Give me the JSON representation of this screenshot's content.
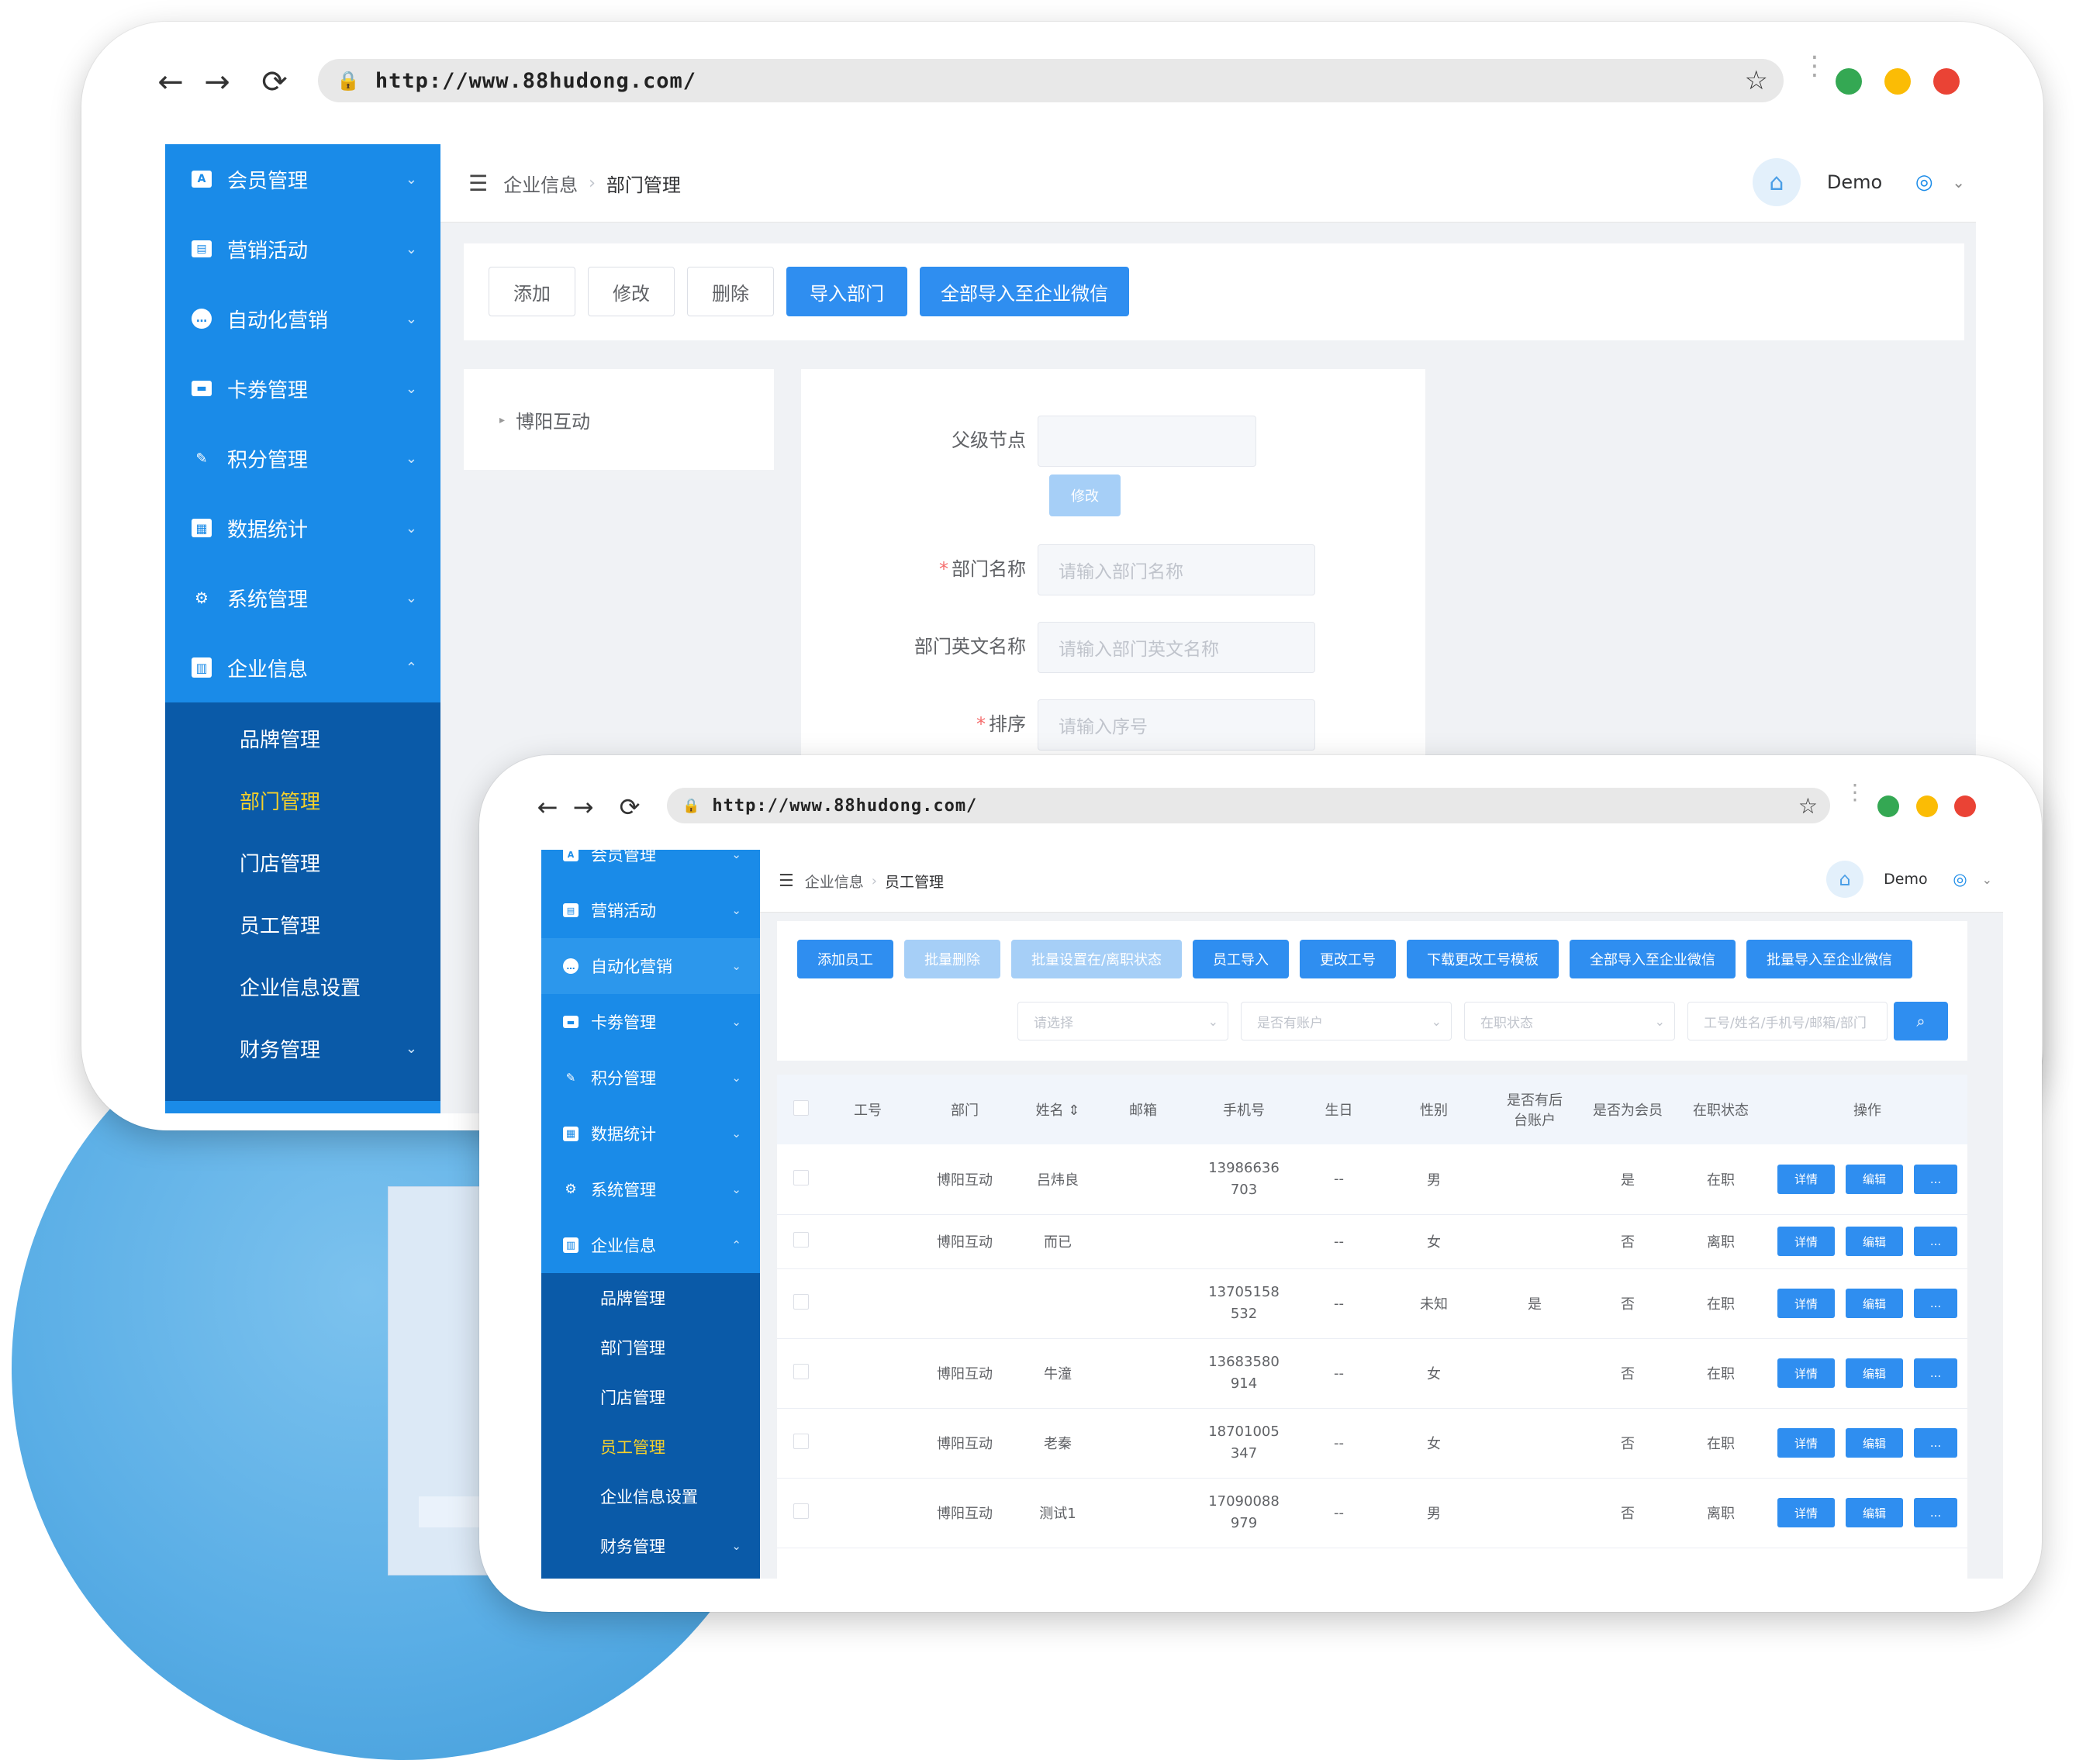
{
  "browser": {
    "url": "http://www.88hudong.com/",
    "light_colors": [
      "#34a853",
      "#fbbc05",
      "#ea4335"
    ]
  },
  "sidebar": {
    "items": [
      {
        "label": "会员管理",
        "icon": "member-card-icon",
        "glyph": "A"
      },
      {
        "label": "营销活动",
        "icon": "ticket-icon",
        "glyph": "▤"
      },
      {
        "label": "自动化营销",
        "icon": "chat-icon",
        "glyph": "…"
      },
      {
        "label": "卡劵管理",
        "icon": "card-icon",
        "glyph": "▬"
      },
      {
        "label": "积分管理",
        "icon": "pen-icon",
        "glyph": "✎"
      },
      {
        "label": "数据统计",
        "icon": "grid-icon",
        "glyph": "▦"
      },
      {
        "label": "系统管理",
        "icon": "gear-icon",
        "glyph": "⚙"
      },
      {
        "label": "企业信息",
        "icon": "building-icon",
        "glyph": "▥"
      }
    ],
    "sub_items": [
      "品牌管理",
      "部门管理",
      "门店管理",
      "员工管理",
      "企业信息设置",
      "财务管理"
    ]
  },
  "user": {
    "name": "Demo"
  },
  "dept_page": {
    "breadcrumb": [
      "企业信息",
      "部门管理"
    ],
    "toolbar": [
      "添加",
      "修改",
      "删除",
      "导入部门",
      "全部导入至企业微信"
    ],
    "tree_root": "博阳互动",
    "form": {
      "parent_label": "父级节点",
      "modify_label": "修改",
      "name_label": "部门名称",
      "name_placeholder": "请输入部门名称",
      "en_label": "部门英文名称",
      "en_placeholder": "请输入部门英文名称",
      "sort_label": "排序",
      "sort_placeholder": "请输入序号"
    }
  },
  "staff_page": {
    "breadcrumb": [
      "企业信息",
      "员工管理"
    ],
    "toolbar": [
      "添加员工",
      "批量删除",
      "批量设置在/离职状态",
      "员工导入",
      "更改工号",
      "下载更改工号模板",
      "全部导入至企业微信",
      "批量导入至企业微信"
    ],
    "filters": [
      "请选择",
      "是否有账户",
      "在职状态"
    ],
    "search_placeholder": "工号/姓名/手机号/邮箱/部门",
    "columns": [
      "工号",
      "部门",
      "姓名 ⇕",
      "邮箱",
      "手机号",
      "生日",
      "性别",
      "是否有后台账户",
      "是否为会员",
      "在职状态",
      "操作"
    ],
    "rows": [
      {
        "id": "",
        "dept": "博阳互动",
        "name": "吕炜良",
        "email": "",
        "phone": "13986636703",
        "birthday": "--",
        "gender": "男",
        "admin": "",
        "member": "是",
        "status": "在职"
      },
      {
        "id": "",
        "dept": "博阳互动",
        "name": "而已",
        "email": "",
        "phone": "",
        "birthday": "--",
        "gender": "女",
        "admin": "",
        "member": "否",
        "status": "离职"
      },
      {
        "id": "",
        "dept": "",
        "name": "",
        "email": "",
        "phone": "13705158532",
        "birthday": "--",
        "gender": "未知",
        "admin": "是",
        "member": "否",
        "status": "在职"
      },
      {
        "id": "",
        "dept": "博阳互动",
        "name": "牛潼",
        "email": "",
        "phone": "13683580914",
        "birthday": "--",
        "gender": "女",
        "admin": "",
        "member": "否",
        "status": "在职"
      },
      {
        "id": "",
        "dept": "博阳互动",
        "name": "老秦",
        "email": "",
        "phone": "18701005347",
        "birthday": "--",
        "gender": "女",
        "admin": "",
        "member": "否",
        "status": "在职"
      },
      {
        "id": "",
        "dept": "博阳互动",
        "name": "测试1",
        "email": "",
        "phone": "17090088979",
        "birthday": "--",
        "gender": "男",
        "admin": "",
        "member": "否",
        "status": "离职"
      }
    ],
    "row_actions": [
      "详情",
      "编辑",
      "..."
    ]
  }
}
